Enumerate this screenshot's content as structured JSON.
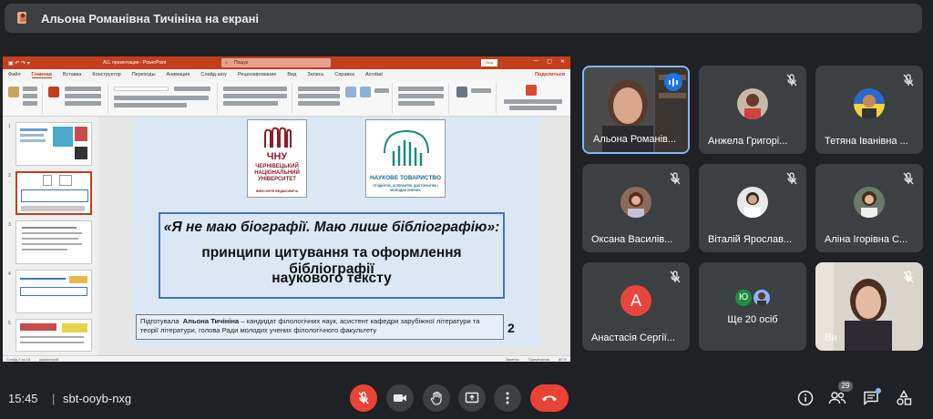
{
  "banner": {
    "title": "Альона Романівна Тичініна на екрані"
  },
  "ppt": {
    "file_name": "ALL презентация - PowerPoint",
    "search": "Пошук",
    "signin": "Вхід",
    "menu": [
      "Файл",
      "Главная",
      "Вставка",
      "Конструктор",
      "Переходы",
      "Анимация",
      "Слайд-шоу",
      "Рецензирование",
      "Вид",
      "Запись",
      "Справка",
      "Acrobat"
    ],
    "share": "Поделиться",
    "status_left": "Слайд 2 из 15",
    "status_lang": "украинский",
    "status_notes": "Заметки",
    "status_comments": "Примечания",
    "zoom": "85 %",
    "slide": {
      "logo1_text": "ЧЕРНІВЕЦЬКИЙ НАЦІОНАЛЬНИЙ УНІВЕРСИТЕТ",
      "logo1_sub": "ІМЕНІ ЮРІЯ ФЕДЬКОВИЧА",
      "logo1_mark": "ЧНУ",
      "logo2_text": "НАУКОВЕ ТОВАРИСТВО",
      "logo2_sub": "СТУДЕНТІВ, АСПІРАНТІВ, ДОКТОРАНТІВ І МОЛОДИХ ВЧЕНИХ",
      "quote_line1": "«Я не маю біографії. Маю лише бібліографію»:",
      "quote_line2": "принципи цитування та оформлення бібліографії",
      "quote_line3": "наукового тексту",
      "author_prefix": "Підготувала",
      "author_name": "Альона Тичініна",
      "author_rest": "– кандидат філологічних наук, асистент кафедри зарубіжної літератури та теорії літератури, голова Ради молодих учених філологічного факультету",
      "number": "2"
    }
  },
  "participants": [
    {
      "name": "Альона Романів...",
      "speaking": true
    },
    {
      "name": "Анжела Григорі..."
    },
    {
      "name": "Тетяна Іванівна ..."
    },
    {
      "name": "Оксана Василів..."
    },
    {
      "name": "Віталій Ярослав..."
    },
    {
      "name": "Аліна Ігорівна С..."
    },
    {
      "name": "Анастасія Сергії...",
      "initial": "А",
      "color": "#e8453c"
    },
    {
      "name": "Ще 20 осіб",
      "initial": "Ю"
    },
    {
      "name": "Ви"
    }
  ],
  "bottom": {
    "time": "15:45",
    "separator": "|",
    "meeting_code": "sbt-ooyb-nxg",
    "participants_count": "29"
  }
}
